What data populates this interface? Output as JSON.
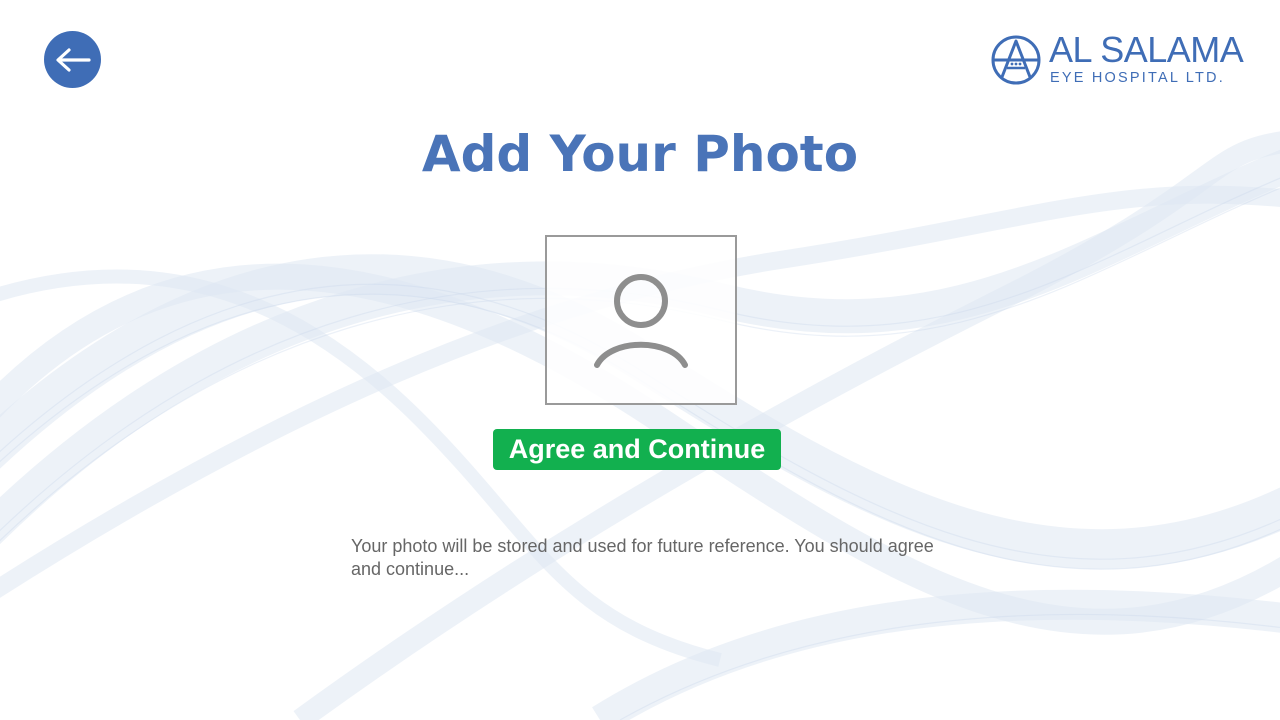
{
  "header": {
    "back_icon": "arrow-left-icon",
    "logo": {
      "name": "AL SALAMA",
      "subtitle": "EYE HOSPITAL LTD."
    }
  },
  "main": {
    "title": "Add Your Photo",
    "photo_placeholder_icon": "user-avatar-icon",
    "agree_button_label": "Agree and Continue",
    "notice": "Your photo will be stored and used for future reference. You should agree and continue..."
  },
  "colors": {
    "brand_blue": "#3f6db6",
    "title_blue": "#4a74b8",
    "agree_green": "#12b04f",
    "notice_gray": "#666666",
    "frame_gray": "#9a9a9a"
  }
}
